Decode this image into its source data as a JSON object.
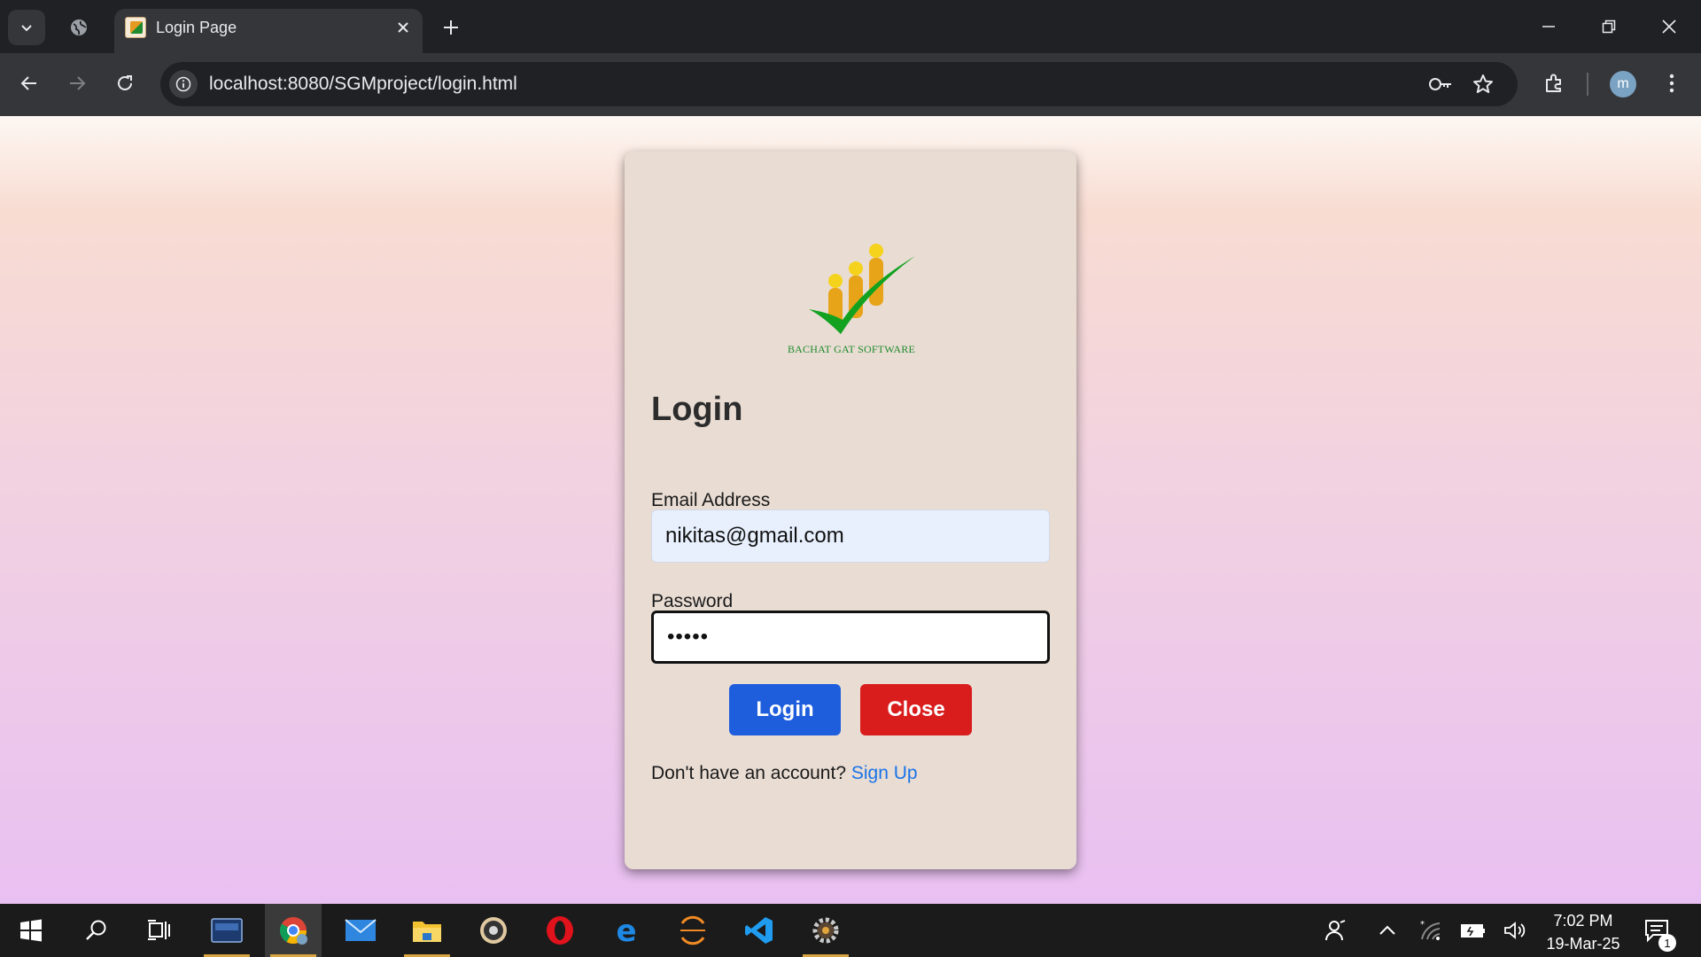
{
  "browser": {
    "tab_title": "Login Page",
    "url": "localhost:8080/SGMproject/login.html",
    "profile_initial": "m"
  },
  "login": {
    "logo_text": "BACHAT GAT SOFTWARE",
    "heading": "Login",
    "email_label": "Email Address",
    "email_value": "nikitas@gmail.com",
    "password_label": "Password",
    "password_value": "•••••",
    "login_button": "Login",
    "close_button": "Close",
    "signup_prompt": "Don't have an account?",
    "signup_link": "Sign Up"
  },
  "taskbar": {
    "time": "7:02 PM",
    "date": "19-Mar-25",
    "notification_count": "1",
    "apps": [
      "mysql-workbench",
      "chrome",
      "mail",
      "file-explorer",
      "media-player",
      "opera",
      "edge",
      "eclipse",
      "vscode",
      "settings-app"
    ]
  },
  "colors": {
    "login_button": "#1e5edc",
    "close_button": "#d91c1c",
    "link": "#1a73e8",
    "card": "#e8dcd3"
  }
}
